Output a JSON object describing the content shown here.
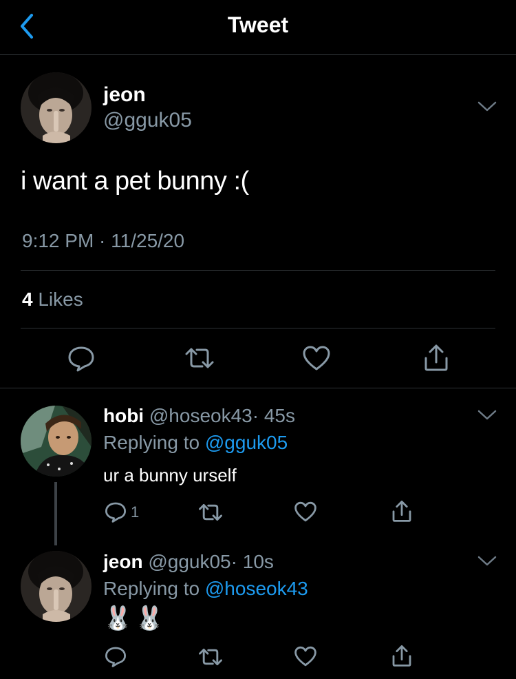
{
  "header": {
    "title": "Tweet"
  },
  "main_tweet": {
    "name": "jeon",
    "handle": "@gguk05",
    "text": "i want a pet bunny :(",
    "timestamp": "9:12 PM · 11/25/20",
    "likes_count": "4",
    "likes_label": "Likes"
  },
  "replies": [
    {
      "name": "hobi",
      "handle": "@hoseok43",
      "time": "· 45s",
      "replying_prefix": "Replying to",
      "replying_to": "@gguk05",
      "text": "ur a bunny urself",
      "reply_count": "1"
    },
    {
      "name": "jeon",
      "handle": "@gguk05",
      "time": "· 10s",
      "replying_prefix": "Replying to",
      "replying_to": "@hoseok43",
      "text": "🐰🐰"
    }
  ],
  "colors": {
    "background": "#000000",
    "link": "#1d9bf0",
    "muted": "#8899a6",
    "divider": "#2f3336"
  },
  "icons": [
    "back-chevron-icon",
    "reply-icon",
    "retweet-icon",
    "like-icon",
    "share-icon",
    "chevron-down-icon",
    "bunny-emoji"
  ]
}
